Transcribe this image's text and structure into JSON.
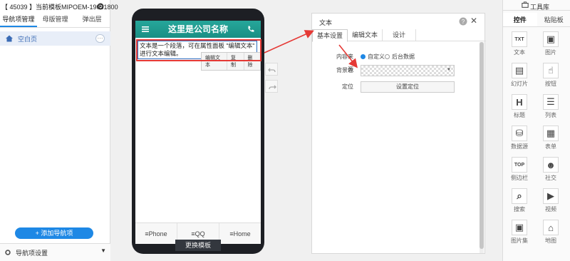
{
  "left_panel": {
    "site_title": "【 45039 】当前模板MIPOEM-19051800",
    "tabs": [
      "导航项管理",
      "母版管理",
      "弹出层"
    ],
    "page_item": "空白页",
    "add_button": "+ 添加导航项",
    "settings_label": "导航项设置"
  },
  "phone": {
    "header_title": "这里是公司名称",
    "text_block": "文本是一个段落，可在属性面板 \"编辑文本\" 进行文本编辑。",
    "toolbar": [
      "编辑文本",
      "复制",
      "删除"
    ],
    "bottom_nav": [
      "Phone",
      "QQ",
      "Home"
    ],
    "change_template": "更换模板"
  },
  "props_panel": {
    "title": "文本",
    "tabs": [
      "基本设置",
      "编辑文本",
      "设计"
    ],
    "content_source_label": "内容来源",
    "content_source_options": [
      "自定义",
      "后台数据"
    ],
    "content_source_selected": "自定义",
    "bg_color_label": "背景色",
    "position_label": "定位",
    "position_button": "设置定位"
  },
  "toolbox": {
    "title": "工具库",
    "tabs": [
      "控件",
      "粘贴板"
    ],
    "items": [
      {
        "label": "文本",
        "icon": "text-widget-icon"
      },
      {
        "label": "图片",
        "icon": "image-widget-icon"
      },
      {
        "label": "幻灯片",
        "icon": "slideshow-icon"
      },
      {
        "label": "按钮",
        "icon": "button-widget-icon"
      },
      {
        "label": "标题",
        "icon": "heading-icon"
      },
      {
        "label": "列表",
        "icon": "list-icon"
      },
      {
        "label": "数据源",
        "icon": "database-icon"
      },
      {
        "label": "表单",
        "icon": "form-icon"
      },
      {
        "label": "侧边栏",
        "icon": "sidebar-top-icon"
      },
      {
        "label": "社交",
        "icon": "social-icon"
      },
      {
        "label": "搜索",
        "icon": "search-icon"
      },
      {
        "label": "视频",
        "icon": "video-icon"
      },
      {
        "label": "图片集",
        "icon": "gallery-icon"
      },
      {
        "label": "地图",
        "icon": "map-icon"
      }
    ]
  },
  "colors": {
    "accent": "#1e88e5",
    "header": "#1a9185",
    "highlight": "#e53935"
  }
}
